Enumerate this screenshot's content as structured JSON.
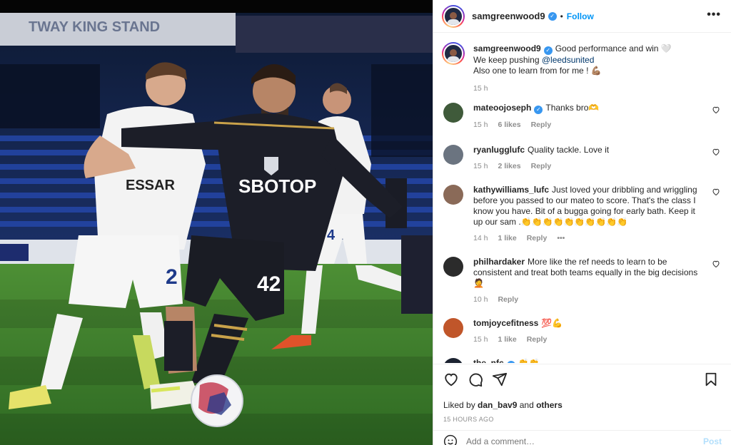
{
  "post": {
    "username": "samgreenwood9",
    "verified_mark": "✓",
    "follow_label": "Follow",
    "more_label": "•••",
    "caption": {
      "text": "Good performance and win 🤍",
      "line2_prefix": "We keep pushing ",
      "line2_mention": "@leedsunited",
      "line3": "Also one to learn from for me ! 💪🏽",
      "time": "15 h"
    },
    "photo": {
      "sponsor_text": "SBOTOP",
      "opponent_sponsor": "ESSAR",
      "shirt_number_left": "2",
      "shirt_number_right": "42",
      "bg_opponent_number": "4",
      "stand_text": "TWAY KING STAND"
    }
  },
  "comments": [
    {
      "user": "mateoojoseph",
      "verified": true,
      "text": "Thanks bro🫶",
      "time": "15 h",
      "likes": "6 likes",
      "reply": "Reply",
      "avatar_color": "#3f5a3a"
    },
    {
      "user": "ryanlugglufc",
      "verified": false,
      "text": "Quality tackle. Love it",
      "time": "15 h",
      "likes": "2 likes",
      "reply": "Reply",
      "avatar_color": "#6b7480"
    },
    {
      "user": "kathywilliams_lufc",
      "verified": false,
      "text": "Just loved your dribbling and wriggling before you passed to our mateo to score. That's the class I know you have. Bit of a bugga going for early bath. Keep it up our sam .👏👏👏👏👏👏👏👏👏👏",
      "time": "14 h",
      "likes": "1 like",
      "reply": "Reply",
      "extra": "•••",
      "avatar_color": "#8a6a58"
    },
    {
      "user": "philhardaker",
      "verified": false,
      "text": "More like the ref needs to learn to be consistent and treat both teams equally in the big decisions 🤦",
      "time": "10 h",
      "likes": "",
      "reply": "Reply",
      "avatar_color": "#2b2b2b"
    },
    {
      "user": "tomjoycefitness",
      "verified": false,
      "text": "💯💪",
      "time": "15 h",
      "likes": "1 like",
      "reply": "Reply",
      "avatar_color": "#c0562a"
    },
    {
      "user": "the_nfc",
      "verified": true,
      "text": "👏👏",
      "time": "",
      "likes": "",
      "reply": "",
      "avatar_color": "#1b2230"
    }
  ],
  "actions": {
    "liked_by_prefix": "Liked by ",
    "liked_by_user": "dan_bav9",
    "liked_by_and": " and ",
    "liked_by_others": "others",
    "posted_ago": "15 HOURS AGO",
    "add_comment_placeholder": "Add a comment…",
    "post_label": "Post"
  },
  "colors": {
    "accent": "#0095f6",
    "verified": "#3897f0",
    "leeds_kit": "#1b1d26",
    "leeds_trim": "#c9a24a",
    "tranmere_kit": "#f4f4f4",
    "pitch": "#3f7d2c"
  }
}
